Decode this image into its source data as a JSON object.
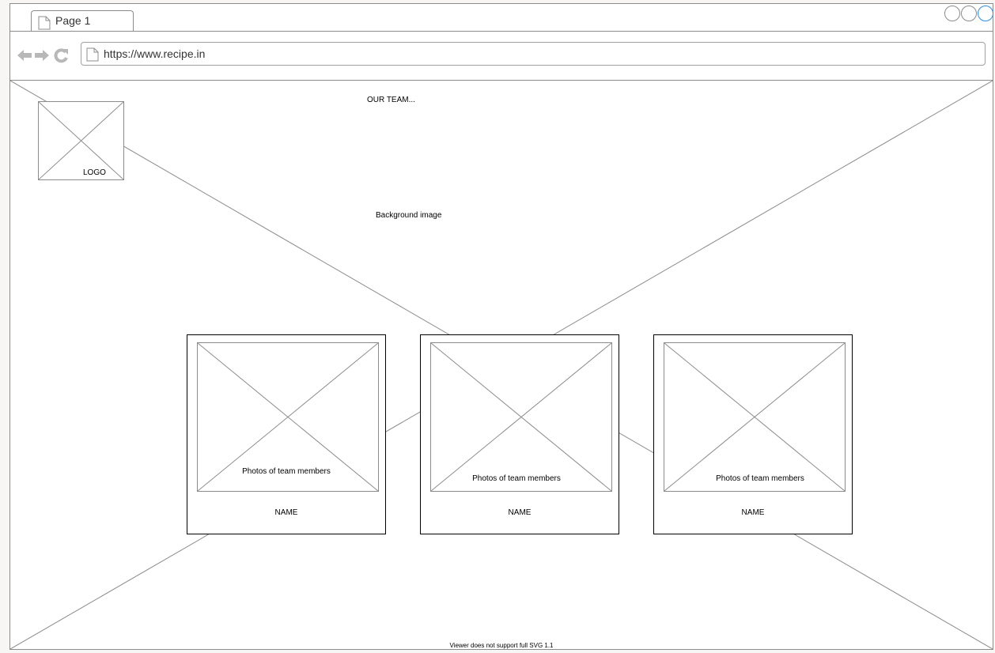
{
  "browser": {
    "tab_label": "Page 1",
    "url": "https://www.recipe.in",
    "accent_color": "#2b8ee8"
  },
  "page": {
    "logo_label": "LOGO",
    "heading": "OUR TEAM...",
    "background_label": "Background image",
    "team_cards": [
      {
        "photo_label": "Photos of team members",
        "name": "NAME"
      },
      {
        "photo_label": "Photos of team members",
        "name": "NAME"
      },
      {
        "photo_label": "Photos of team members",
        "name": "NAME"
      }
    ],
    "viewer_note": "Viewer does not support full SVG 1.1"
  }
}
